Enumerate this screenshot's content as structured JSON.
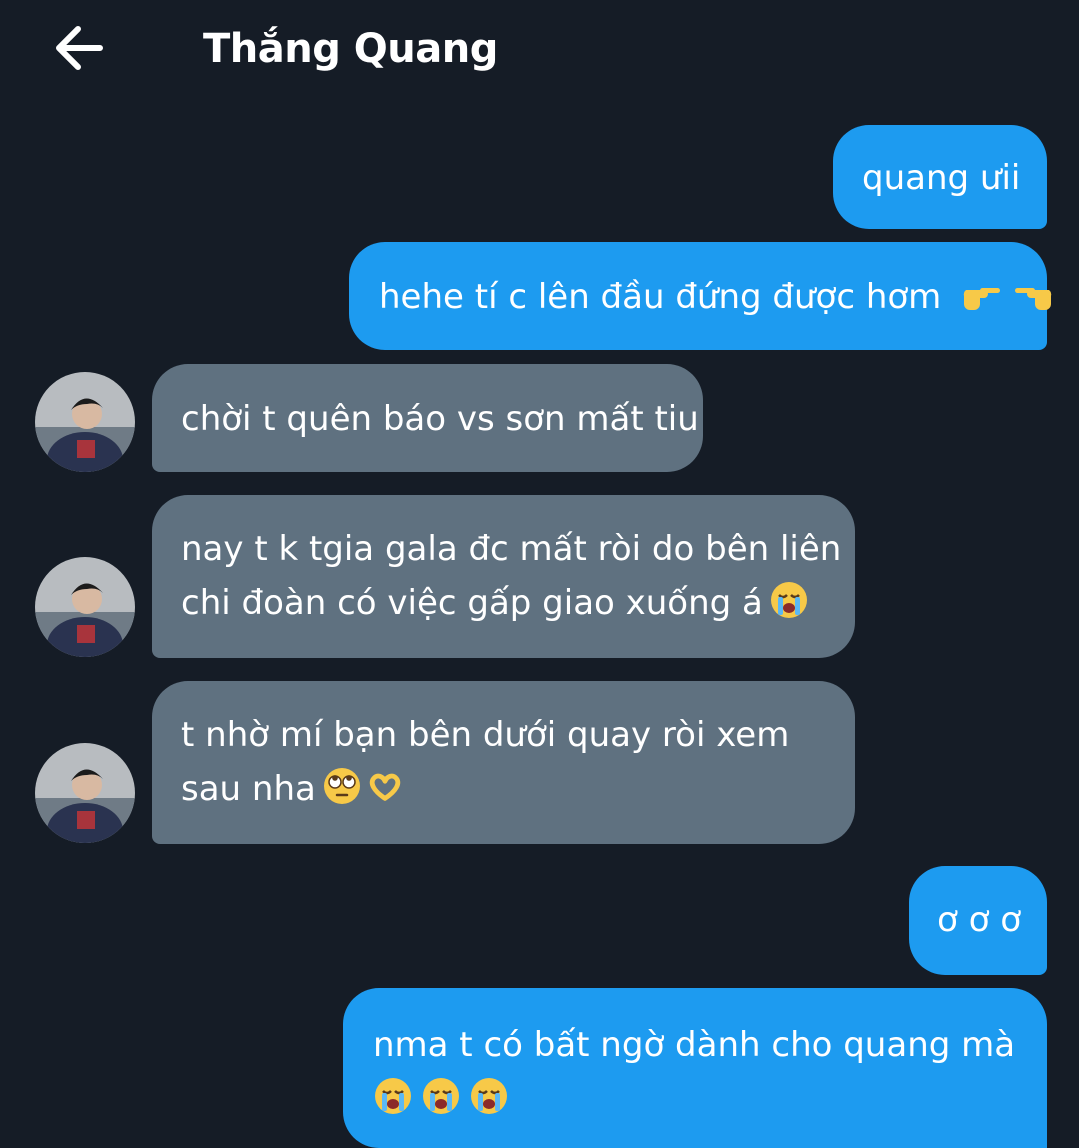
{
  "header": {
    "contact_name": "Thắng Quang"
  },
  "messages": [
    {
      "direction": "outgoing",
      "text": "quang ưii"
    },
    {
      "direction": "outgoing",
      "text": "hehe tí c lên đầu đứng được hơm",
      "emojis": [
        "pointing-right-emoji",
        "pointing-left-emoji"
      ]
    },
    {
      "direction": "incoming",
      "text": "chời t quên báo vs sơn mất tiu"
    },
    {
      "direction": "incoming",
      "lines": [
        "nay t k tgia gala đc mất ròi do bên liên",
        "chi đoàn có việc gấp giao xuống á"
      ],
      "emojis": [
        "loudly-crying-emoji"
      ]
    },
    {
      "direction": "incoming",
      "lines": [
        "t nhờ mí bạn bên dưới quay ròi xem",
        "sau nha"
      ],
      "emojis": [
        "eye-roll-emoji",
        "heart-hands-emoji"
      ]
    },
    {
      "direction": "outgoing",
      "text": "ơ ơ ơ"
    },
    {
      "direction": "outgoing",
      "lines": [
        "nma t có bất ngờ dành cho quang mà",
        ""
      ],
      "emojis": [
        "loudly-crying-emoji",
        "loudly-crying-emoji",
        "loudly-crying-emoji"
      ]
    }
  ],
  "colors": {
    "background": "#151c26",
    "outgoing_bubble": "#1d9bf0",
    "incoming_bubble": "#5f7180"
  }
}
